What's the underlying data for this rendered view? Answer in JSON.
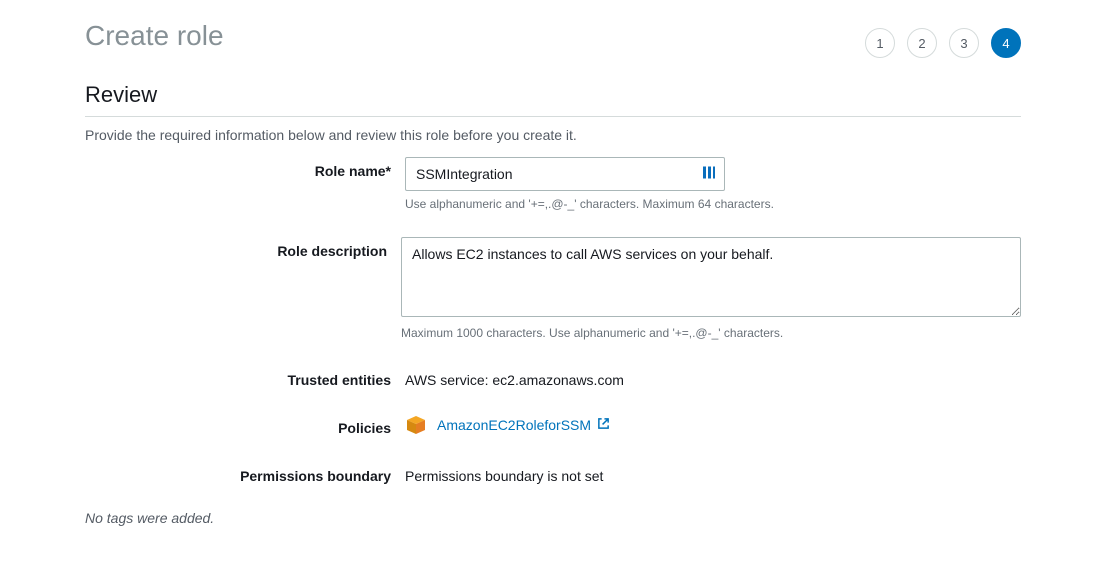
{
  "header": {
    "title": "Create role",
    "steps": [
      "1",
      "2",
      "3",
      "4"
    ],
    "activeStep": 4
  },
  "section": {
    "title": "Review",
    "description": "Provide the required information below and review this role before you create it."
  },
  "fields": {
    "roleName": {
      "label": "Role name*",
      "value": "SSMIntegration",
      "helper": "Use alphanumeric and '+=,.@-_' characters. Maximum 64 characters."
    },
    "roleDescription": {
      "label": "Role description",
      "value": "Allows EC2 instances to call AWS services on your behalf.",
      "helper": "Maximum 1000 characters. Use alphanumeric and '+=,.@-_' characters."
    },
    "trustedEntities": {
      "label": "Trusted entities",
      "value": "AWS service: ec2.amazonaws.com"
    },
    "policies": {
      "label": "Policies",
      "linkText": "AmazonEC2RoleforSSM"
    },
    "permissionsBoundary": {
      "label": "Permissions boundary",
      "value": "Permissions boundary is not set"
    }
  },
  "tags": {
    "message": "No tags were added."
  }
}
